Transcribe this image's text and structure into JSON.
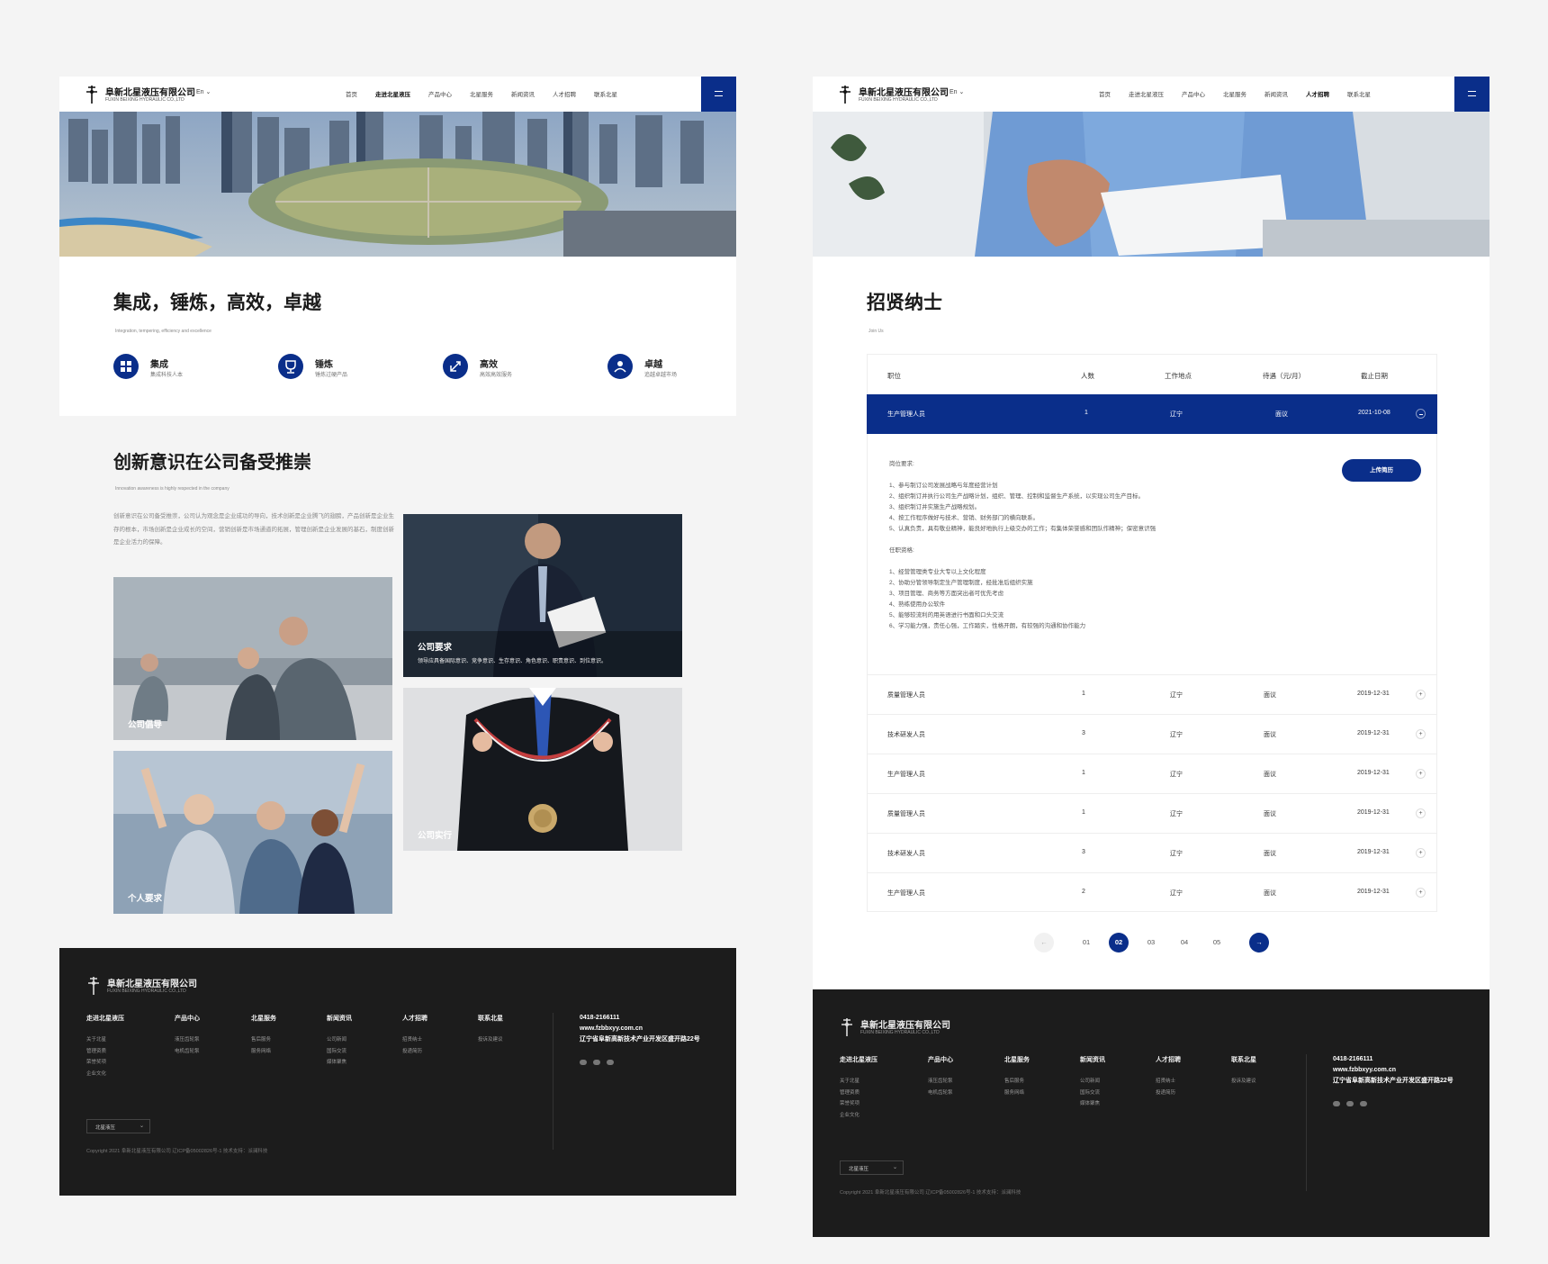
{
  "header": {
    "logo_zh": "阜新北星液压有限公司",
    "logo_en": "FUXIN BEIXING HYDRAULIC CO.,LTD",
    "lang": "En ⌄",
    "nav": [
      "首页",
      "走进北星液压",
      "产品中心",
      "北星服务",
      "新闻资讯",
      "人才招聘",
      "联系北星"
    ]
  },
  "left": {
    "values_title": "集成，锤炼，高效，卓越",
    "values_sub": "Integration, tempering, efficiency and excellence",
    "features": [
      {
        "title": "集成",
        "desc": "集成科技人本",
        "icon": "integration-icon"
      },
      {
        "title": "锤炼",
        "desc": "锤炼过硬产品",
        "icon": "trophy-icon"
      },
      {
        "title": "高效",
        "desc": "高效高效服务",
        "icon": "efficiency-icon"
      },
      {
        "title": "卓越",
        "desc": "追越卓越市场",
        "icon": "excellence-icon"
      }
    ],
    "innov_title": "创新意识在公司备受推崇",
    "innov_sub": "Innovation awareness is highly respected in the company",
    "innov_para": "创新意识在公司备受推崇，公司认为观念是企业成功的导向，技术创新是企业腾飞的翅膀，产品创新是企业生存的根本，市场创新是企业成长的空间，营销创新是市场通道的拓展，管理创新是企业发展的基石，制度创新是企业活力的保障。",
    "cards": [
      {
        "caption": "公司倡导",
        "desc": ""
      },
      {
        "caption": "公司要求",
        "desc": "领导应具备国际意识、竞争意识、生存意识、角色意识、职责意识、到位意识。"
      },
      {
        "caption": "个人要求",
        "desc": ""
      },
      {
        "caption": "公司实行",
        "desc": ""
      }
    ]
  },
  "right": {
    "title": "招贤纳士",
    "sub": "Join Us",
    "table_headers": [
      "职位",
      "人数",
      "工作地点",
      "待遇（元/月）",
      "截止日期"
    ],
    "active_row": [
      "生产管理人员",
      "1",
      "辽宁",
      "面议",
      "2021-10-08"
    ],
    "req_title": "岗位要求:",
    "reqs": [
      "1、参与制订公司发展战略与年度经营计划",
      "2、组织制订并执行公司生产战略计划，组织、管理、控制和监督生产系统，以实现公司生产目标。",
      "3、组织制订并实施生产战略规划。",
      "4、按工作程序做好与技术、营销、财务部门的横向联系。",
      "5、认真负责，具有敬业精神，能良好地执行上级交办的工作；有集体荣誉感和团队作精神；保密意识强"
    ],
    "qual_title": "任职资格:",
    "quals": [
      "1、经营管理类专业大专以上文化程度",
      "2、协助分管领导制定生产管理制度，经批准后组织实施",
      "3、项目管理、商务等方面突出者可优先考虑",
      "4、熟练使用办公软件",
      "5、能够较流利的用英语进行书面和口头交流",
      "6、学习能力强，责任心强，工作踏实，性格开朗，有较强的沟通和协作能力"
    ],
    "upload": "上传简历",
    "rows": [
      [
        "质量管理人员",
        "1",
        "辽宁",
        "面议",
        "2019-12-31"
      ],
      [
        "技术研发人员",
        "3",
        "辽宁",
        "面议",
        "2019-12-31"
      ],
      [
        "生产管理人员",
        "1",
        "辽宁",
        "面议",
        "2019-12-31"
      ],
      [
        "质量管理人员",
        "1",
        "辽宁",
        "面议",
        "2019-12-31"
      ],
      [
        "技术研发人员",
        "3",
        "辽宁",
        "面议",
        "2019-12-31"
      ],
      [
        "生产管理人员",
        "2",
        "辽宁",
        "面议",
        "2019-12-31"
      ]
    ],
    "pages": [
      "01",
      "02",
      "03",
      "04",
      "05"
    ],
    "current_page": "02",
    "prev": "←",
    "next": "→"
  },
  "footer": {
    "cols": [
      {
        "title": "走进北星液压",
        "items": [
          "关于北星",
          "管理资质",
          "荣誉奖项",
          "企业文化"
        ]
      },
      {
        "title": "产品中心",
        "items": [
          "液压齿轮泵",
          "电机齿轮泵"
        ]
      },
      {
        "title": "北星服务",
        "items": [
          "售后服务",
          "服务网络"
        ]
      },
      {
        "title": "新闻资讯",
        "items": [
          "公司新闻",
          "国际交流",
          "媒体聚焦"
        ]
      },
      {
        "title": "人才招聘",
        "items": [
          "招贤纳士",
          "投递简历"
        ]
      },
      {
        "title": "联系北星",
        "items": [
          "投诉及建议"
        ]
      }
    ],
    "phone": "0418-2166111",
    "web": "www.fzbbxyy.com.cn",
    "address": "辽宁省阜新高新技术产业开发区盛开路22号",
    "select": "北星液压",
    "copyright": "Copyright 2021 阜新北星液压有限公司 辽ICP备05002826号-1 技术支持：派澜科技"
  },
  "colors": {
    "brand": "#0a2e8a",
    "footer_bg": "#1c1c1c"
  }
}
